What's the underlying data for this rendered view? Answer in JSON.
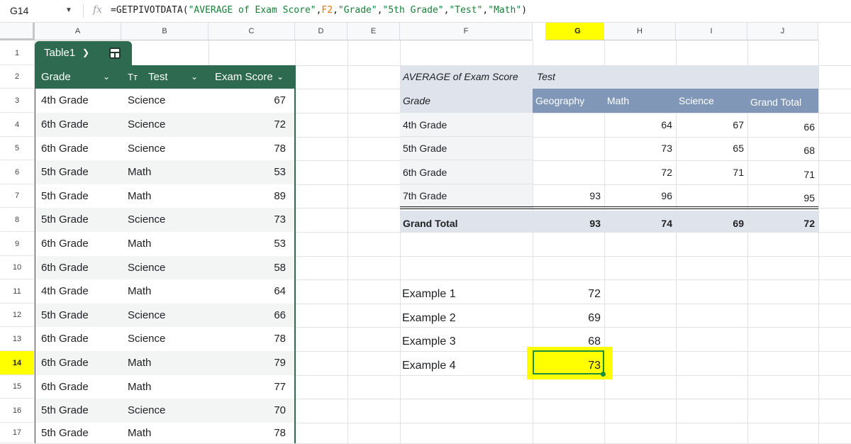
{
  "formula_bar": {
    "name_box": "G14",
    "fx": "fx",
    "f_prefix": "=GETPIVOTDATA(",
    "f_arg1": "\"AVERAGE of Exam Score\"",
    "f_c1": ",",
    "f_arg2": "F2",
    "f_c2": ",",
    "f_arg3": "\"Grade\"",
    "f_c3": ",",
    "f_arg4": "\"5th Grade\"",
    "f_c4": ",",
    "f_arg5": "\"Test\"",
    "f_c5": ",",
    "f_arg6": "\"Math\"",
    "f_suffix": ")"
  },
  "columns": [
    "A",
    "B",
    "C",
    "D",
    "E",
    "F",
    "G",
    "H",
    "I",
    "J"
  ],
  "selected_column": "G",
  "rows": [
    "1",
    "2",
    "3",
    "4",
    "5",
    "6",
    "7",
    "8",
    "9",
    "10",
    "11",
    "12",
    "13",
    "14",
    "15",
    "16",
    "17"
  ],
  "selected_row": "14",
  "table": {
    "name": "Table1",
    "headers": {
      "grade": "Grade",
      "test_type_icon": "Tт",
      "test": "Test",
      "score": "Exam Score"
    },
    "rows": [
      [
        "4th Grade",
        "Science",
        "67"
      ],
      [
        "6th Grade",
        "Science",
        "72"
      ],
      [
        "6th Grade",
        "Science",
        "78"
      ],
      [
        "5th Grade",
        "Math",
        "53"
      ],
      [
        "5th Grade",
        "Math",
        "89"
      ],
      [
        "5th Grade",
        "Science",
        "73"
      ],
      [
        "6th Grade",
        "Math",
        "53"
      ],
      [
        "6th Grade",
        "Science",
        "58"
      ],
      [
        "4th Grade",
        "Math",
        "64"
      ],
      [
        "5th Grade",
        "Science",
        "66"
      ],
      [
        "6th Grade",
        "Science",
        "78"
      ],
      [
        "6th Grade",
        "Math",
        "79"
      ],
      [
        "6th Grade",
        "Math",
        "77"
      ],
      [
        "5th Grade",
        "Science",
        "70"
      ],
      [
        "5th Grade",
        "Math",
        "78"
      ]
    ]
  },
  "pivot": {
    "title": "AVERAGE of Exam Score",
    "col_field": "Test",
    "row_field": "Grade",
    "col_headers": [
      "Geography",
      "Math",
      "Science",
      "Grand Total"
    ],
    "rows": [
      [
        "4th Grade",
        "",
        "64",
        "67",
        "66"
      ],
      [
        "5th Grade",
        "",
        "73",
        "65",
        "68"
      ],
      [
        "6th Grade",
        "",
        "72",
        "71",
        "71"
      ],
      [
        "7th Grade",
        "93",
        "96",
        "",
        "95"
      ]
    ],
    "grand_total": [
      "Grand Total",
      "93",
      "74",
      "69",
      "72"
    ]
  },
  "examples": [
    [
      "Example 1",
      "72"
    ],
    [
      "Example 2",
      "69"
    ],
    [
      "Example 3",
      "68"
    ],
    [
      "Example 4",
      "73"
    ]
  ],
  "colors": {
    "table_header": "#2d6a4f",
    "pivot_header": "#8097b8",
    "pivot_light": "#dfe4ec",
    "highlight": "#ffff00"
  }
}
